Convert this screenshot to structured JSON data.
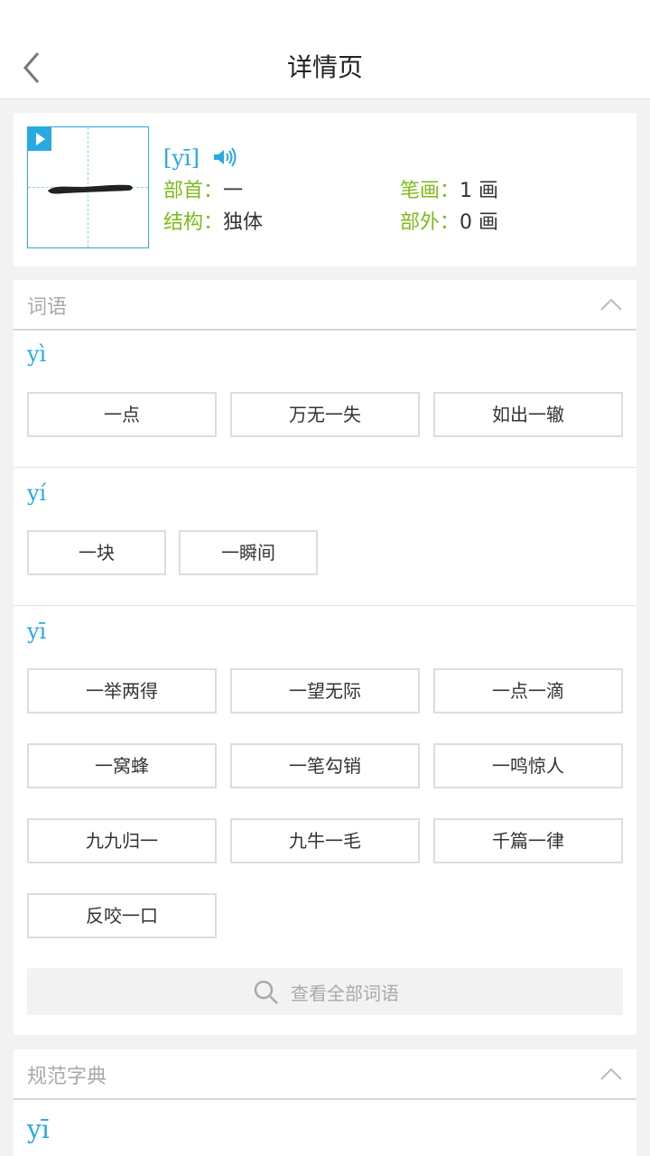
{
  "header": {
    "title": "详情页"
  },
  "character": {
    "glyph": "一",
    "pinyin": "[yī]",
    "radical_label": "部首：",
    "radical_value": "一",
    "strokes_label": "笔画：",
    "strokes_value": "1 画",
    "structure_label": "结构：",
    "structure_value": "独体",
    "extra_label": "部外：",
    "extra_value": "0 画"
  },
  "words_section": {
    "title": "词语",
    "groups": [
      {
        "pinyin": "yì",
        "words": [
          "一点",
          "万无一失",
          "如出一辙"
        ]
      },
      {
        "pinyin": "yí",
        "words": [
          "一块",
          "一瞬间"
        ]
      },
      {
        "pinyin": "yī",
        "words": [
          "一举两得",
          "一望无际",
          "一点一滴",
          "一窝蜂",
          "一笔勾销",
          "一鸣惊人",
          "九九归一",
          "九牛一毛",
          "千篇一律",
          "反咬一口"
        ]
      }
    ],
    "view_all_label": "查看全部词语"
  },
  "dict_section": {
    "title": "规范字典",
    "pinyin": "yī"
  },
  "colors": {
    "accent": "#29a9e1",
    "label_green": "#7dbb1a",
    "muted": "#aaaaaa"
  }
}
